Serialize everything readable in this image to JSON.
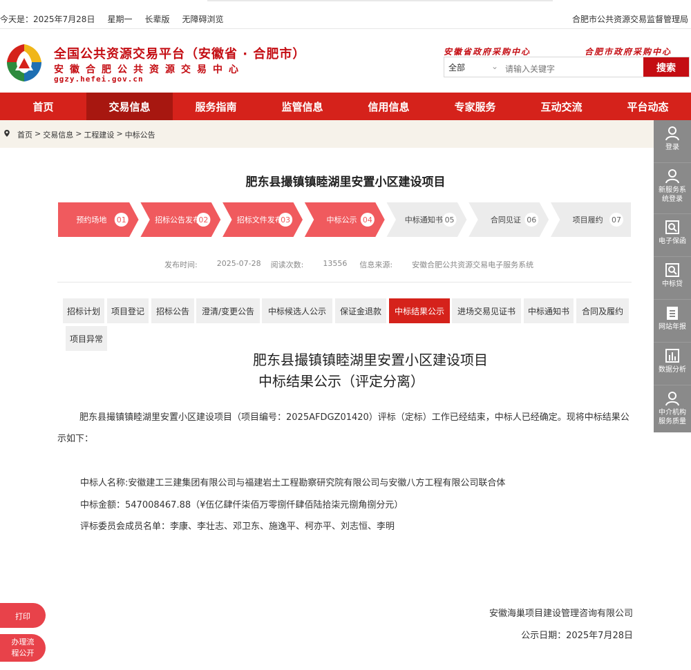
{
  "topbar": {
    "date": "今天是：2025年7月28日",
    "weekday": "星期一",
    "elder_mode": "长辈版",
    "accessible": "无障碍浏览",
    "authority": "合肥市公共资源交易监督管理局"
  },
  "brand": {
    "title": "全国公共资源交易平台（安徽省 · 合肥市）",
    "subtitle": "安徽合肥公共资源交易中心",
    "url": "ggzy.hefei.gov.cn",
    "link_province": "安徽省政府采购中心",
    "link_city": "合肥市政府采购中心",
    "logo_colors": [
      "#d5221b",
      "#2e8b3e",
      "#1e6fb3",
      "#f0b619"
    ]
  },
  "search": {
    "select_value": "全部",
    "placeholder": "请输入关键字",
    "button": "搜索"
  },
  "nav": {
    "items": [
      "首页",
      "交易信息",
      "服务指南",
      "监管信息",
      "信用信息",
      "专家服务",
      "互动交流",
      "平台动态"
    ],
    "active_index": 1
  },
  "breadcrumb": {
    "home": "首页",
    "l1": "交易信息",
    "l2": "工程建设",
    "l3": "中标公告",
    "sep": ">"
  },
  "sidebar": {
    "items": [
      {
        "label": "登录",
        "icon": "user-icon"
      },
      {
        "label": "新服务系统登录",
        "icon": "user-icon"
      },
      {
        "label": "电子保函",
        "icon": "search-doc-icon"
      },
      {
        "label": "中标贷",
        "icon": "search-doc-icon"
      },
      {
        "label": "网站年报",
        "icon": "clipboard-icon"
      },
      {
        "label": "数据分析",
        "icon": "bar-chart-icon"
      },
      {
        "label": "中介机构服务质量",
        "icon": "user-icon"
      }
    ]
  },
  "project_title": "肥东县撮镇镇睦湖里安置小区建设项目",
  "steps": {
    "items": [
      {
        "label": "预约场地",
        "num": "01",
        "done": true
      },
      {
        "label": "招标公告发布",
        "num": "02",
        "done": true
      },
      {
        "label": "招标文件发布",
        "num": "03",
        "done": true
      },
      {
        "label": "中标公示",
        "num": "04",
        "done": true
      },
      {
        "label": "中标通知书",
        "num": "05",
        "done": false
      },
      {
        "label": "合同见证",
        "num": "06",
        "done": false
      },
      {
        "label": "项目履约",
        "num": "07",
        "done": false
      }
    ],
    "color_done": "#f05a5e",
    "color_todo": "#ececec"
  },
  "meta": {
    "publish_label": "发布时间:",
    "publish_date": "2025-07-28",
    "views_label": "阅读次数:",
    "views": "13556",
    "source_label": "信息来源:",
    "source": "安徽合肥公共资源交易电子服务系统"
  },
  "tabs": {
    "items": [
      "招标计划",
      "项目登记",
      "招标公告",
      "澄清/变更公告",
      "中标候选人公示",
      "保证金退款",
      "中标结果公示",
      "进场交易见证书",
      "中标通知书",
      "合同及履约",
      "项目异常"
    ],
    "active_index": 6
  },
  "doc": {
    "title_line1": "肥东县撮镇镇睦湖里安置小区建设项目",
    "title_line2": "中标结果公示（评定分离）",
    "intro": "肥东县撮镇镇睦湖里安置小区建设项目（项目编号：2025AFDGZ01420）评标（定标）工作已经结束，中标人已经确定。现将中标结果公示如下：",
    "winner_label": "中标人名称:",
    "winner": "安徽建工三建集团有限公司与福建岩土工程勘察研究院有限公司与安徽八方工程有限公司联合体",
    "amount_label": "中标金额：",
    "amount": "547008467.88（¥伍亿肆仟柒佰万零捌仟肆佰陆拾柒元捌角捌分元）",
    "committee_label": "评标委员会成员名单：",
    "committee": "李康、李壮志、邓卫东、施逸平、柯亦平、刘志恒、李明",
    "agency": "安徽海巢项目建设管理咨询有限公司",
    "date_label": "公示日期：",
    "date": "2025年7月28日"
  },
  "float": {
    "print": "打印",
    "flow_line1": "办理流",
    "flow_line2": "程公开"
  }
}
